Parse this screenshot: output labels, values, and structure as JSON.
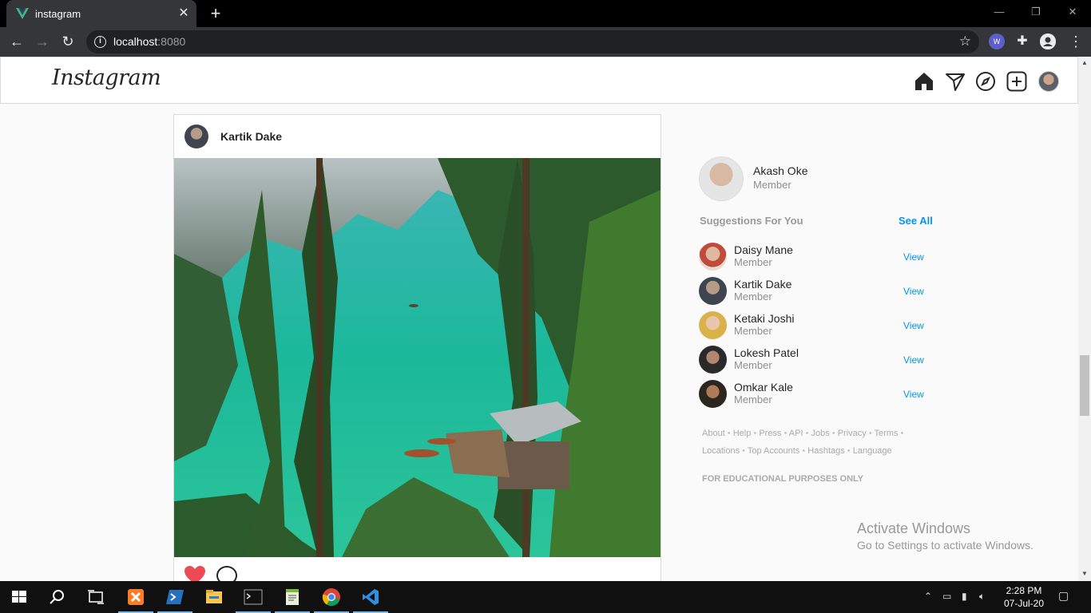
{
  "browser": {
    "tab_title": "instagram",
    "new_tab_glyph": "+",
    "close_glyph": "✕",
    "url_host": "localhost",
    "url_port": ":8080"
  },
  "app": {
    "logo": "Instagram",
    "nav_icons": [
      "home-icon",
      "direct-icon",
      "explore-icon",
      "new-post-icon",
      "profile-avatar"
    ]
  },
  "post": {
    "username": "Kartik Dake",
    "liked": true,
    "colors": {
      "heart": "#ed4956",
      "lake": "#21b79e"
    }
  },
  "sidebar": {
    "me": {
      "name": "Akash Oke",
      "role": "Member"
    },
    "suggestions_title": "Suggestions For You",
    "see_all": "See All",
    "suggestions": [
      {
        "name": "Daisy Mane",
        "role": "Member",
        "action": "View"
      },
      {
        "name": "Kartik Dake",
        "role": "Member",
        "action": "View"
      },
      {
        "name": "Ketaki Joshi",
        "role": "Member",
        "action": "View"
      },
      {
        "name": "Lokesh Patel",
        "role": "Member",
        "action": "View"
      },
      {
        "name": "Omkar Kale",
        "role": "Member",
        "action": "View"
      }
    ],
    "footer_line1": [
      "About",
      "Help",
      "Press",
      "API",
      "Jobs",
      "Privacy",
      "Terms"
    ],
    "footer_line2": [
      "Locations",
      "Top Accounts",
      "Hashtags",
      "Language"
    ],
    "educational": "FOR EDUCATIONAL PURPOSES ONLY"
  },
  "watermark": {
    "line1": "Activate Windows",
    "line2": "Go to Settings to activate Windows."
  },
  "taskbar": {
    "time": "2:28 PM",
    "date": "07-Jul-20",
    "accent": "#76b9ed"
  }
}
